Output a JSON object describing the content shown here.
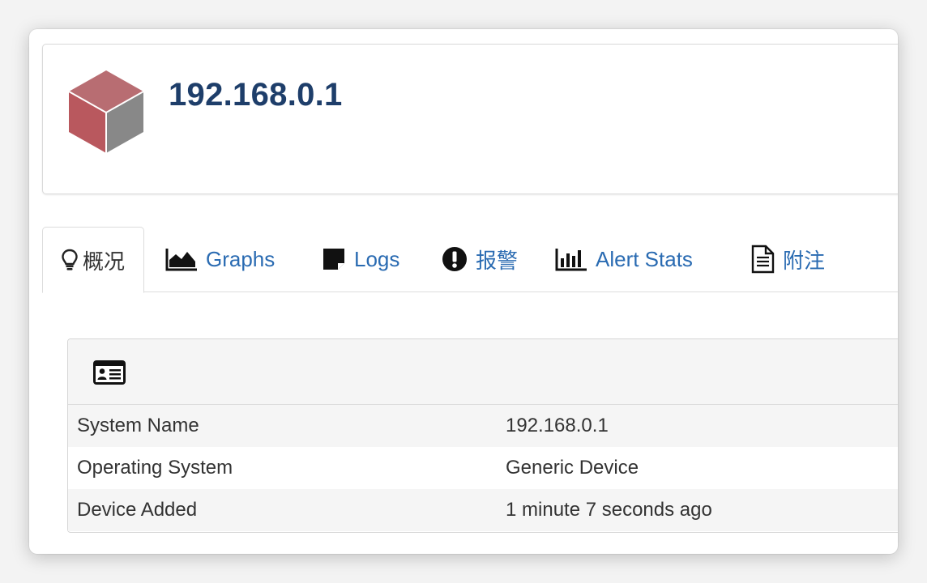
{
  "device": {
    "title": "192.168.0.1",
    "icon": "cube-icon",
    "icon_colors": {
      "top": "#b76a6e",
      "left": "#b9595e",
      "right": "#878787"
    }
  },
  "tabs": [
    {
      "label": "概况",
      "icon": "lightbulb-icon",
      "active": true
    },
    {
      "label": "Graphs",
      "icon": "area-chart-icon",
      "active": false
    },
    {
      "label": "Logs",
      "icon": "sticky-note-icon",
      "active": false
    },
    {
      "label": "报警",
      "icon": "exclamation-circle-icon",
      "active": false
    },
    {
      "label": "Alert Stats",
      "icon": "bar-chart-icon",
      "active": false
    },
    {
      "label": "附注",
      "icon": "file-text-icon",
      "active": false
    }
  ],
  "overview": {
    "heading_icon": "id-card-icon",
    "rows": [
      {
        "label": "System Name",
        "value": "192.168.0.1"
      },
      {
        "label": "Operating System",
        "value": "Generic Device"
      },
      {
        "label": "Device Added",
        "value": "1 minute 7 seconds ago"
      }
    ]
  },
  "colors": {
    "title": "#1e3e6a",
    "link": "#2a6bb2",
    "active_tab_text": "#333333",
    "row_alt": "#f5f5f5"
  }
}
